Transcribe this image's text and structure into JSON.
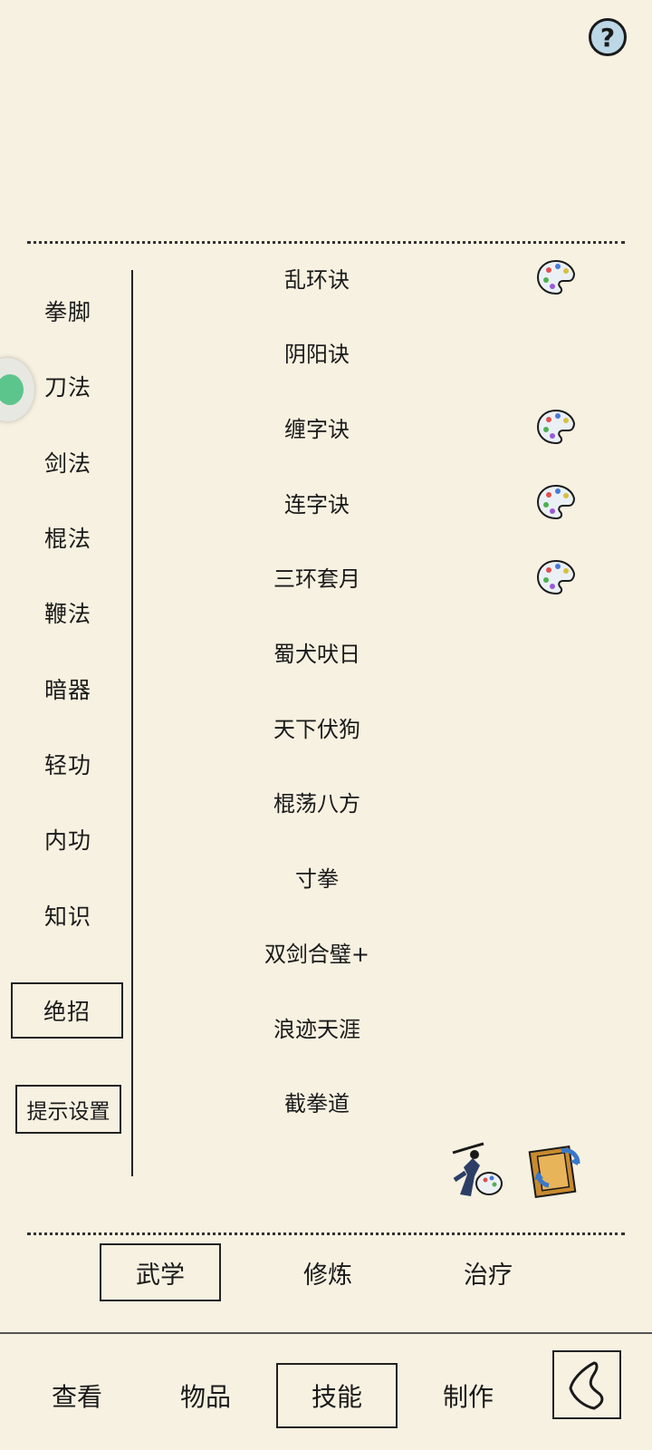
{
  "header": {
    "help_icon": "question-mark-icon",
    "help_label": "?"
  },
  "categories": [
    {
      "label": "拳脚"
    },
    {
      "label": "刀法"
    },
    {
      "label": "剑法"
    },
    {
      "label": "棍法"
    },
    {
      "label": "鞭法"
    },
    {
      "label": "暗器"
    },
    {
      "label": "轻功"
    },
    {
      "label": "内功"
    },
    {
      "label": "知识"
    },
    {
      "label": "绝招",
      "active": true
    }
  ],
  "hint_settings_label": "提示设置",
  "skills": [
    {
      "name": "乱环诀",
      "has_palette": true
    },
    {
      "name": "阴阳诀",
      "has_palette": false
    },
    {
      "name": "缠字诀",
      "has_palette": true
    },
    {
      "name": "连字诀",
      "has_palette": true
    },
    {
      "name": "三环套月",
      "has_palette": true
    },
    {
      "name": "蜀犬吠日",
      "has_palette": false
    },
    {
      "name": "天下伏狗",
      "has_palette": false
    },
    {
      "name": "棍荡八方",
      "has_palette": false
    },
    {
      "name": "寸拳",
      "has_palette": false
    },
    {
      "name": "双剑合璧+",
      "has_palette": false
    },
    {
      "name": "浪迹天涯",
      "has_palette": false
    },
    {
      "name": "截拳道",
      "has_palette": false
    }
  ],
  "bottom_icons": [
    {
      "name": "ninja-palette-icon"
    },
    {
      "name": "swap-scroll-icon"
    }
  ],
  "subtabs": [
    {
      "label": "武学",
      "active": true
    },
    {
      "label": "修炼",
      "active": false
    },
    {
      "label": "治疗",
      "active": false
    }
  ],
  "nav_tabs": [
    {
      "label": "查看",
      "active": false
    },
    {
      "label": "物品",
      "active": false
    },
    {
      "label": "技能",
      "active": true
    },
    {
      "label": "制作",
      "active": false
    }
  ],
  "back_icon": "back-arrow-icon",
  "colors": {
    "background": "#f7f1e1",
    "ink": "#1a1a1a",
    "help_fill": "#bcd7e6"
  }
}
